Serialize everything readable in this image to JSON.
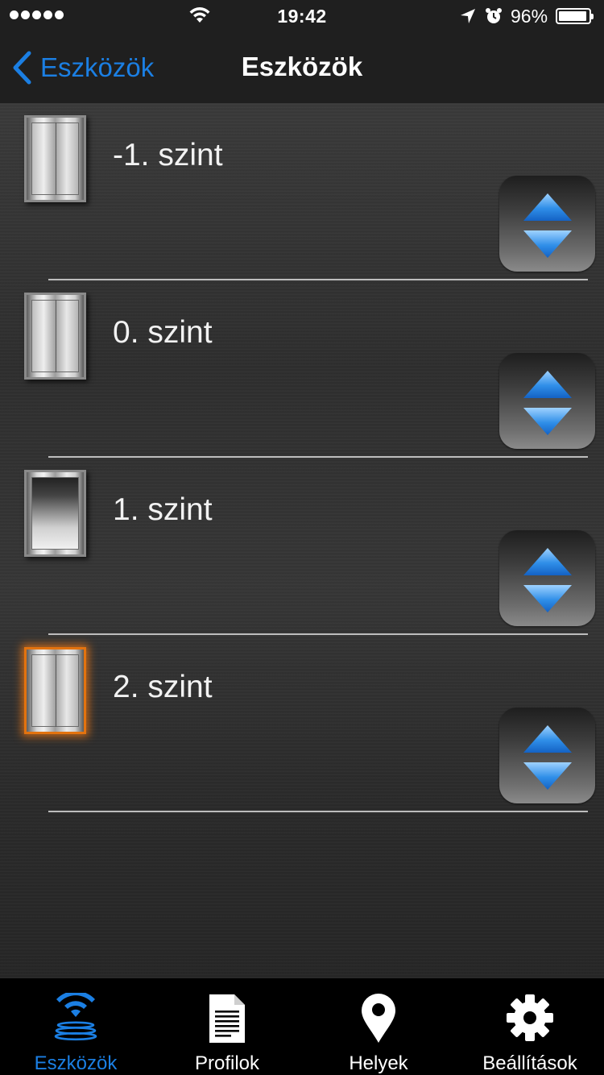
{
  "status_bar": {
    "time": "19:42",
    "battery": "96%"
  },
  "nav": {
    "back_label": "Eszközök",
    "title": "Eszközök"
  },
  "floors": [
    {
      "label": "-1. szint",
      "selected": false,
      "image": "elevator-door-closed"
    },
    {
      "label": "0. szint",
      "selected": false,
      "image": "elevator-door-closed"
    },
    {
      "label": "1. szint",
      "selected": false,
      "image": "elevator-cabin-open"
    },
    {
      "label": "2. szint",
      "selected": true,
      "image": "elevator-door-closed"
    }
  ],
  "tabs": [
    {
      "label": "Eszközök",
      "icon": "wireless-devices-icon",
      "active": true
    },
    {
      "label": "Profilok",
      "icon": "document-icon",
      "active": false
    },
    {
      "label": "Helyek",
      "icon": "location-pin-icon",
      "active": false
    },
    {
      "label": "Beállítások",
      "icon": "gear-icon",
      "active": false
    }
  ],
  "colors": {
    "accent": "#1b7fe3",
    "selected_glow": "#e3730f",
    "arrow_blue": "#2f8ee8"
  }
}
